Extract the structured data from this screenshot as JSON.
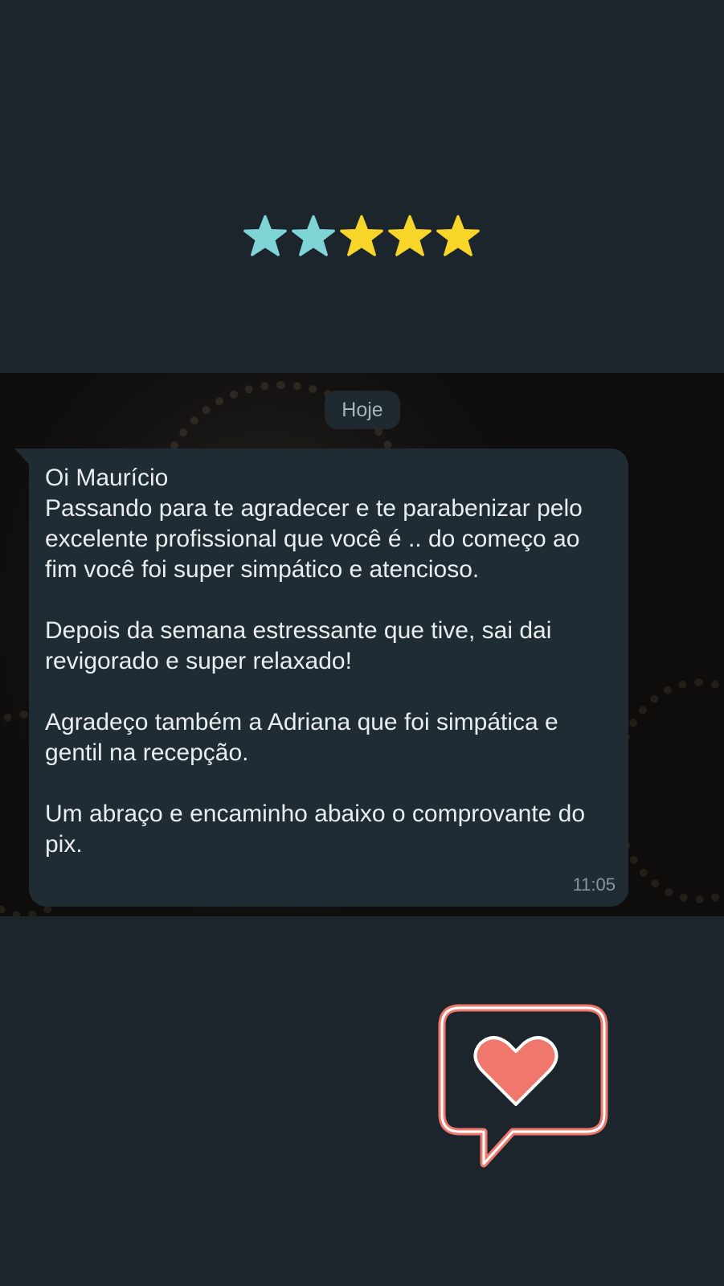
{
  "rating": {
    "stars": 5,
    "colors": [
      "#7fd4d6",
      "#7fd4d6",
      "#f7d529",
      "#f7d529",
      "#f7d529"
    ]
  },
  "chat": {
    "date_label": "Hoje",
    "message": {
      "paragraphs": [
        "Oi Maurício\nPassando para te agradecer e te parabenizar pelo excelente profissional que você é .. do começo ao fim você foi super simpático e atencioso.",
        "Depois da semana estressante que tive, sai dai revigorado e super relaxado!",
        "Agradeço também a Adriana que foi simpática e gentil na recepção.",
        "Um abraço e encaminho abaixo o comprovante do pix."
      ],
      "time": "11:05"
    }
  },
  "icons": {
    "rating_star": "star-icon",
    "heart_badge": "heart-speech-bubble-icon"
  },
  "colors": {
    "background": "#1c242c",
    "bubble": "#1f2c33",
    "heart": "#f0776b",
    "heart_outline": "#ffffff"
  }
}
